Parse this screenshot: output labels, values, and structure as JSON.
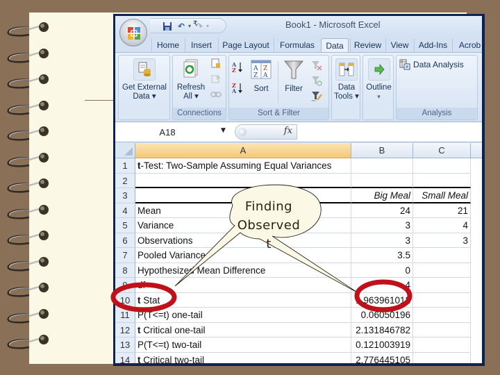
{
  "slide": {
    "background_color": "#8b7058",
    "paper_color": "#fbf9e6",
    "spiral_count": 13
  },
  "window": {
    "title": "Book1  -  Microsoft Excel",
    "quick_access": [
      "save-icon",
      "undo-icon",
      "redo-icon",
      "customize-icon"
    ],
    "tabs": [
      {
        "label": "Home",
        "active": false
      },
      {
        "label": "Insert",
        "active": false
      },
      {
        "label": "Page Layout",
        "active": false
      },
      {
        "label": "Formulas",
        "active": false
      },
      {
        "label": "Data",
        "active": true
      },
      {
        "label": "Review",
        "active": false
      },
      {
        "label": "View",
        "active": false
      },
      {
        "label": "Add-Ins",
        "active": false
      },
      {
        "label": "Acrob",
        "active": false
      }
    ]
  },
  "ribbon": {
    "groups": [
      {
        "label": "",
        "buttons": [
          {
            "label": "Get External",
            "label2": "Data ▾",
            "icon": "database-icon"
          }
        ]
      },
      {
        "label": "Connections",
        "buttons": [
          {
            "label": "Refresh",
            "label2": "All ▾",
            "icon": "refresh-icon"
          }
        ],
        "small_icons": [
          "connections-icon",
          "properties-icon",
          "edit-links-icon"
        ]
      },
      {
        "label": "Sort & Filter",
        "buttons": [
          {
            "label": "Sort",
            "icon": "sort-dialog-icon"
          },
          {
            "label": "Filter",
            "icon": "filter-icon"
          }
        ],
        "small_icons": [
          "sort-a-z-icon",
          "sort-z-a-icon",
          "clear-filter-icon",
          "reapply-filter-icon",
          "advanced-filter-icon"
        ]
      },
      {
        "label": "",
        "buttons": [
          {
            "label": "Data",
            "label2": "Tools ▾",
            "icon": "data-tools-icon"
          }
        ]
      },
      {
        "label": "",
        "buttons": [
          {
            "label": "Outline",
            "label2": "▾",
            "icon": "outline-icon"
          }
        ]
      },
      {
        "label": "Analysis",
        "buttons": [
          {
            "label": "Data Analysis",
            "icon": "data-analysis-icon"
          }
        ]
      }
    ]
  },
  "formula_bar": {
    "name_box": "A18",
    "fx_label": "fx",
    "formula": ""
  },
  "sheet": {
    "columns": [
      "A",
      "B",
      "C"
    ],
    "selected_column": "A",
    "rows": [
      {
        "num": "1",
        "a": "t-Test: Two-Sample Assuming Equal Variances",
        "b": "",
        "c": ""
      },
      {
        "num": "2",
        "a": "",
        "b": "",
        "c": ""
      },
      {
        "num": "3",
        "a": "",
        "b": "Big Meal",
        "c": "Small Meal"
      },
      {
        "num": "4",
        "a": "Mean",
        "b": "24",
        "c": "21"
      },
      {
        "num": "5",
        "a": "Variance",
        "b": "3",
        "c": "4"
      },
      {
        "num": "6",
        "a": "Observations",
        "b": "3",
        "c": "3"
      },
      {
        "num": "7",
        "a": "Pooled Variance",
        "b": "3.5",
        "c": ""
      },
      {
        "num": "8",
        "a": "Hypothesized Mean Difference",
        "b": "0",
        "c": ""
      },
      {
        "num": "9",
        "a": "df",
        "b": "4",
        "c": ""
      },
      {
        "num": "10",
        "a": "t Stat",
        "b": "1.963961012",
        "c": ""
      },
      {
        "num": "11",
        "a": "P(T<=t) one-tail",
        "b": "0.06050196",
        "c": ""
      },
      {
        "num": "12",
        "a": "t Critical one-tail",
        "b": "2.131846782",
        "c": ""
      },
      {
        "num": "13",
        "a": "P(T<=t) two-tail",
        "b": "0.121003919",
        "c": ""
      },
      {
        "num": "14",
        "a": "t Critical two-tail",
        "b": "2.776445105",
        "c": ""
      }
    ]
  },
  "annotation": {
    "callout_line1": "Finding",
    "callout_line2": "Observed",
    "callout_line3": "t",
    "highlight_color": "#c0101a",
    "highlighted_cells": [
      "A10",
      "B10"
    ]
  }
}
